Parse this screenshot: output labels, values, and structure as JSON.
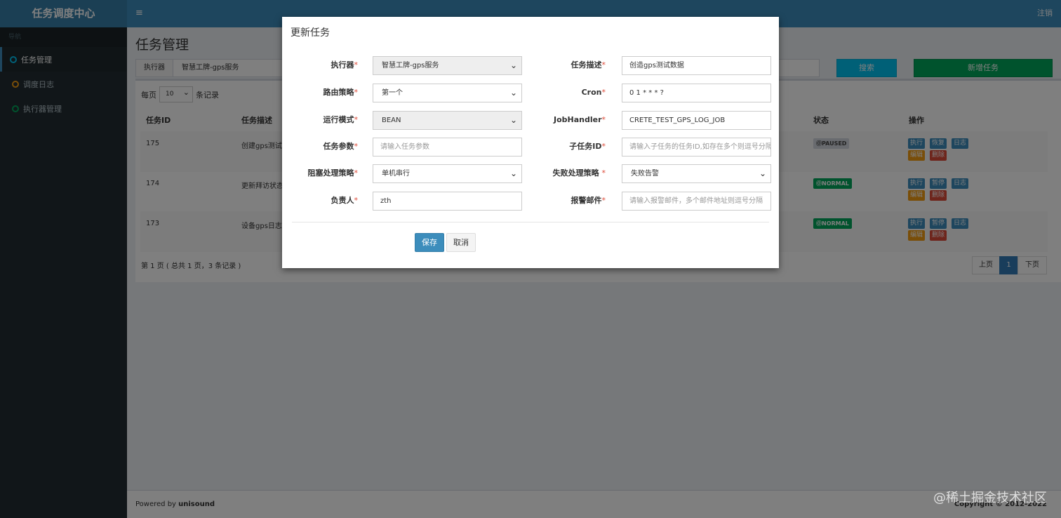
{
  "header": {
    "logo": "任务调度中心",
    "toggle_icon": "≡",
    "logout": "注销"
  },
  "sidebar": {
    "nav_label": "导航",
    "items": [
      {
        "label": "任务管理",
        "color": "#00c0ef",
        "active": true
      },
      {
        "label": "调度日志",
        "color": "#f39c12",
        "active": false
      },
      {
        "label": "执行器管理",
        "color": "#00a65a",
        "active": false
      }
    ]
  },
  "main": {
    "title": "任务管理",
    "filter": {
      "addon": "执行器",
      "value": "智慧工牌-gps服务"
    },
    "search_button": "搜索",
    "add_button": "新增任务",
    "per_page_prefix": "每页",
    "per_page_value": "10",
    "per_page_suffix": "条记录",
    "columns": {
      "id": "任务ID",
      "desc": "任务描述",
      "status": "状态",
      "ops": "操作"
    },
    "rows": [
      {
        "id": "175",
        "desc": "创建gps测试",
        "status": "ⓄPAUSED",
        "ops": [
          "执行",
          "恢复",
          "日志",
          "编辑",
          "删除"
        ]
      },
      {
        "id": "174",
        "desc": "更新拜访状态",
        "status": "ⓄNORMAL",
        "ops": [
          "执行",
          "暂停",
          "日志",
          "编辑",
          "删除"
        ]
      },
      {
        "id": "173",
        "desc": "设备gps日志",
        "status": "ⓄNORMAL",
        "ops": [
          "执行",
          "暂停",
          "日志",
          "编辑",
          "删除"
        ]
      }
    ],
    "summary": "第 1 页 ( 总共 1 页，3 条记录 )",
    "pager": {
      "prev": "上页",
      "current": "1",
      "next": "下页"
    }
  },
  "footer": {
    "powered_prefix": "Powered by ",
    "powered_brand": "unisound",
    "copyright": "Copyright © 2012-2022"
  },
  "modal": {
    "title": "更新任务",
    "required_mark": "*",
    "fields": {
      "executor": {
        "label": "执行器",
        "value": "智慧工牌-gps服务"
      },
      "job_desc": {
        "label": "任务描述",
        "value": "创造gps测试数据"
      },
      "route": {
        "label": "路由策略",
        "value": "第一个"
      },
      "cron": {
        "label": "Cron",
        "value": "0 1 * * * ?"
      },
      "glue_type": {
        "label": "运行模式",
        "value": "BEAN"
      },
      "handler": {
        "label": "JobHandler",
        "value": "CRETE_TEST_GPS_LOG_JOB"
      },
      "param": {
        "label": "任务参数",
        "placeholder": "请输入任务参数"
      },
      "child_id": {
        "label": "子任务ID",
        "placeholder": "请输入子任务的任务ID,如存在多个则逗号分隔"
      },
      "block": {
        "label": "阻塞处理策略",
        "value": "单机串行"
      },
      "fail": {
        "label": "失败处理策略 ",
        "value": "失败告警"
      },
      "author": {
        "label": "负责人",
        "value": "zth"
      },
      "alarm_email": {
        "label": "报警邮件",
        "placeholder": "请输入报警邮件，多个邮件地址则逗号分隔"
      }
    },
    "save": "保存",
    "cancel": "取消"
  },
  "watermark": "@稀土掘金技术社区"
}
